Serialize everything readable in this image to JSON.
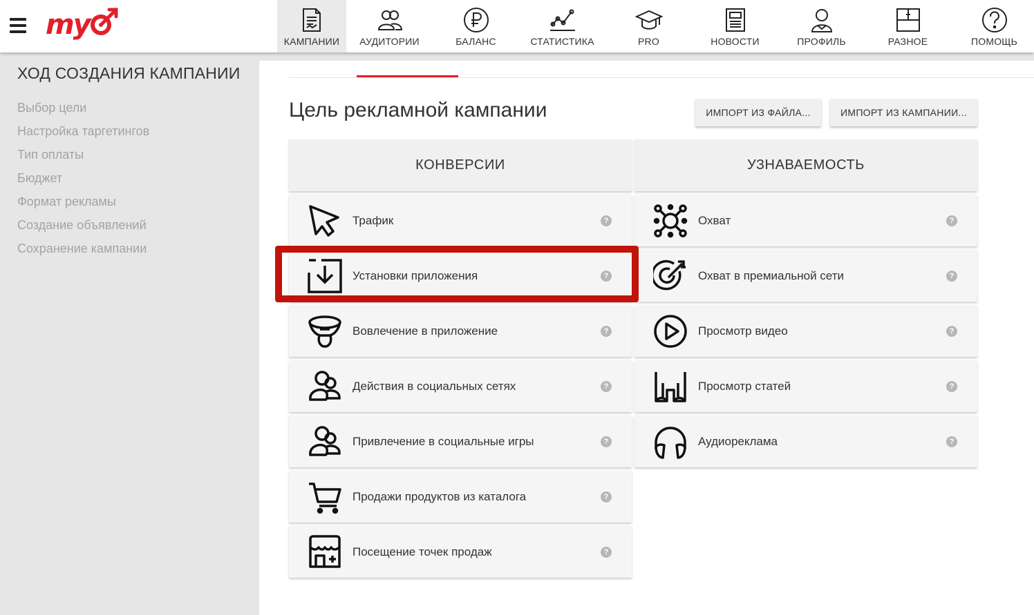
{
  "header": {
    "logo_text": "my",
    "nav": [
      {
        "label": "КАМПАНИИ",
        "icon": "campaigns-icon",
        "active": true
      },
      {
        "label": "АУДИТОРИИ",
        "icon": "audiences-icon"
      },
      {
        "label": "БАЛАНС",
        "icon": "ruble-icon"
      },
      {
        "label": "СТАТИСТИКА",
        "icon": "statistics-icon"
      },
      {
        "label": "PRO",
        "icon": "graduation-cap-icon"
      },
      {
        "label": "НОВОСТИ",
        "icon": "news-icon"
      },
      {
        "label": "ПРОФИЛЬ",
        "icon": "profile-icon"
      },
      {
        "label": "РАЗНОЕ",
        "icon": "misc-icon"
      },
      {
        "label": "ПОМОЩЬ",
        "icon": "help-icon"
      }
    ]
  },
  "sidebar": {
    "title": "ХОД СОЗДАНИЯ КАМПАНИИ",
    "steps": [
      "Выбор цели",
      "Настройка таргетингов",
      "Тип оплаты",
      "Бюджет",
      "Формат рекламы",
      "Создание объявлений",
      "Сохранение кампании"
    ]
  },
  "main": {
    "title": "Цель рекламной кампании",
    "buttons": {
      "import_file": "ИМПОРТ ИЗ ФАЙЛА...",
      "import_campaign": "ИМПОРТ ИЗ КАМПАНИИ..."
    },
    "help_glyph": "?",
    "conversions": {
      "heading": "КОНВЕРСИИ",
      "items": [
        {
          "label": "Трафик",
          "icon": "cursor-icon"
        },
        {
          "label": "Установки приложения",
          "icon": "download-icon"
        },
        {
          "label": "Вовлечение в приложение",
          "icon": "funnel-icon"
        },
        {
          "label": "Действия в социальных сетях",
          "icon": "social-people-icon"
        },
        {
          "label": "Привлечение в социальные игры",
          "icon": "social-games-icon"
        },
        {
          "label": "Продажи продуктов из каталога",
          "icon": "cart-icon"
        },
        {
          "label": "Посещение точек продаж",
          "icon": "store-icon"
        }
      ]
    },
    "awareness": {
      "heading": "УЗНАВАЕМОСТЬ",
      "items": [
        {
          "label": "Охват",
          "icon": "reach-icon"
        },
        {
          "label": "Охват в премиальной сети",
          "icon": "target-icon"
        },
        {
          "label": "Просмотр видео",
          "icon": "play-icon"
        },
        {
          "label": "Просмотр статей",
          "icon": "glasses-icon"
        },
        {
          "label": "Аудиореклама",
          "icon": "headphones-icon"
        }
      ]
    }
  },
  "colors": {
    "accent": "#e2202a",
    "highlight": "#c1140c",
    "sidebar_bg": "#e6e6e6",
    "muted_text": "#a3a3a3"
  }
}
